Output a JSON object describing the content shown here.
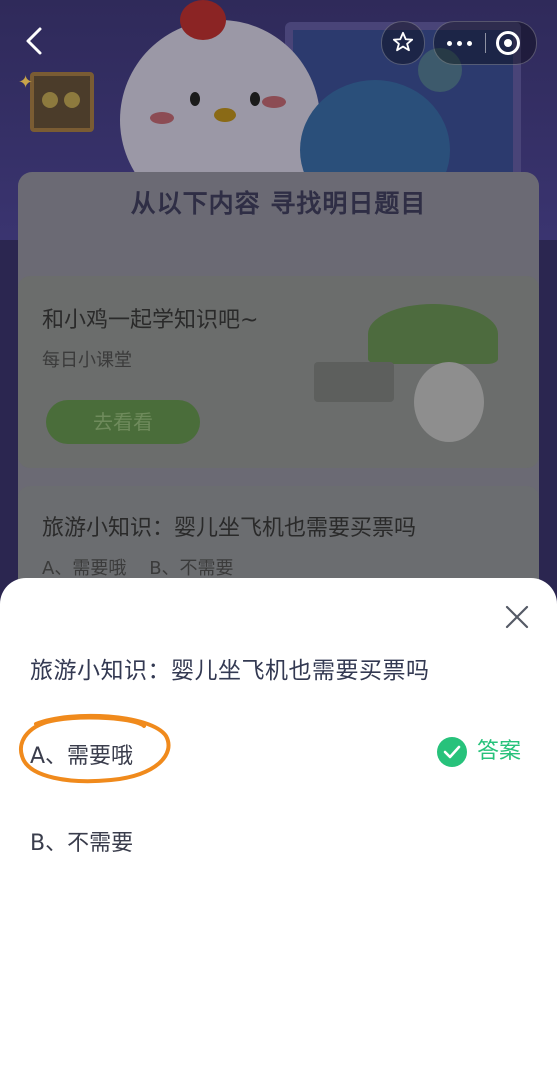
{
  "nav": {
    "back_icon": "back-arrow-icon",
    "star_icon": "star-outline-icon",
    "more_icon": "more-dots-icon",
    "close_mini_icon": "record-target-icon"
  },
  "background": {
    "banner_title": "从以下内容 寻找明日题目",
    "card1": {
      "title": "和小鸡一起学知识吧~",
      "subtitle": "每日小课堂",
      "button": "去看看"
    },
    "card2": {
      "title": "旅游小知识：婴儿坐飞机也需要买票吗",
      "options": "A、需要哦    B、不需要"
    }
  },
  "sheet": {
    "question": "旅游小知识：婴儿坐飞机也需要买票吗",
    "option_a": "A、需要哦",
    "option_b": "B、不需要",
    "answer_label": "答案",
    "colors": {
      "answer_green": "#27c27b",
      "annotation_orange": "#f08a1c"
    }
  }
}
